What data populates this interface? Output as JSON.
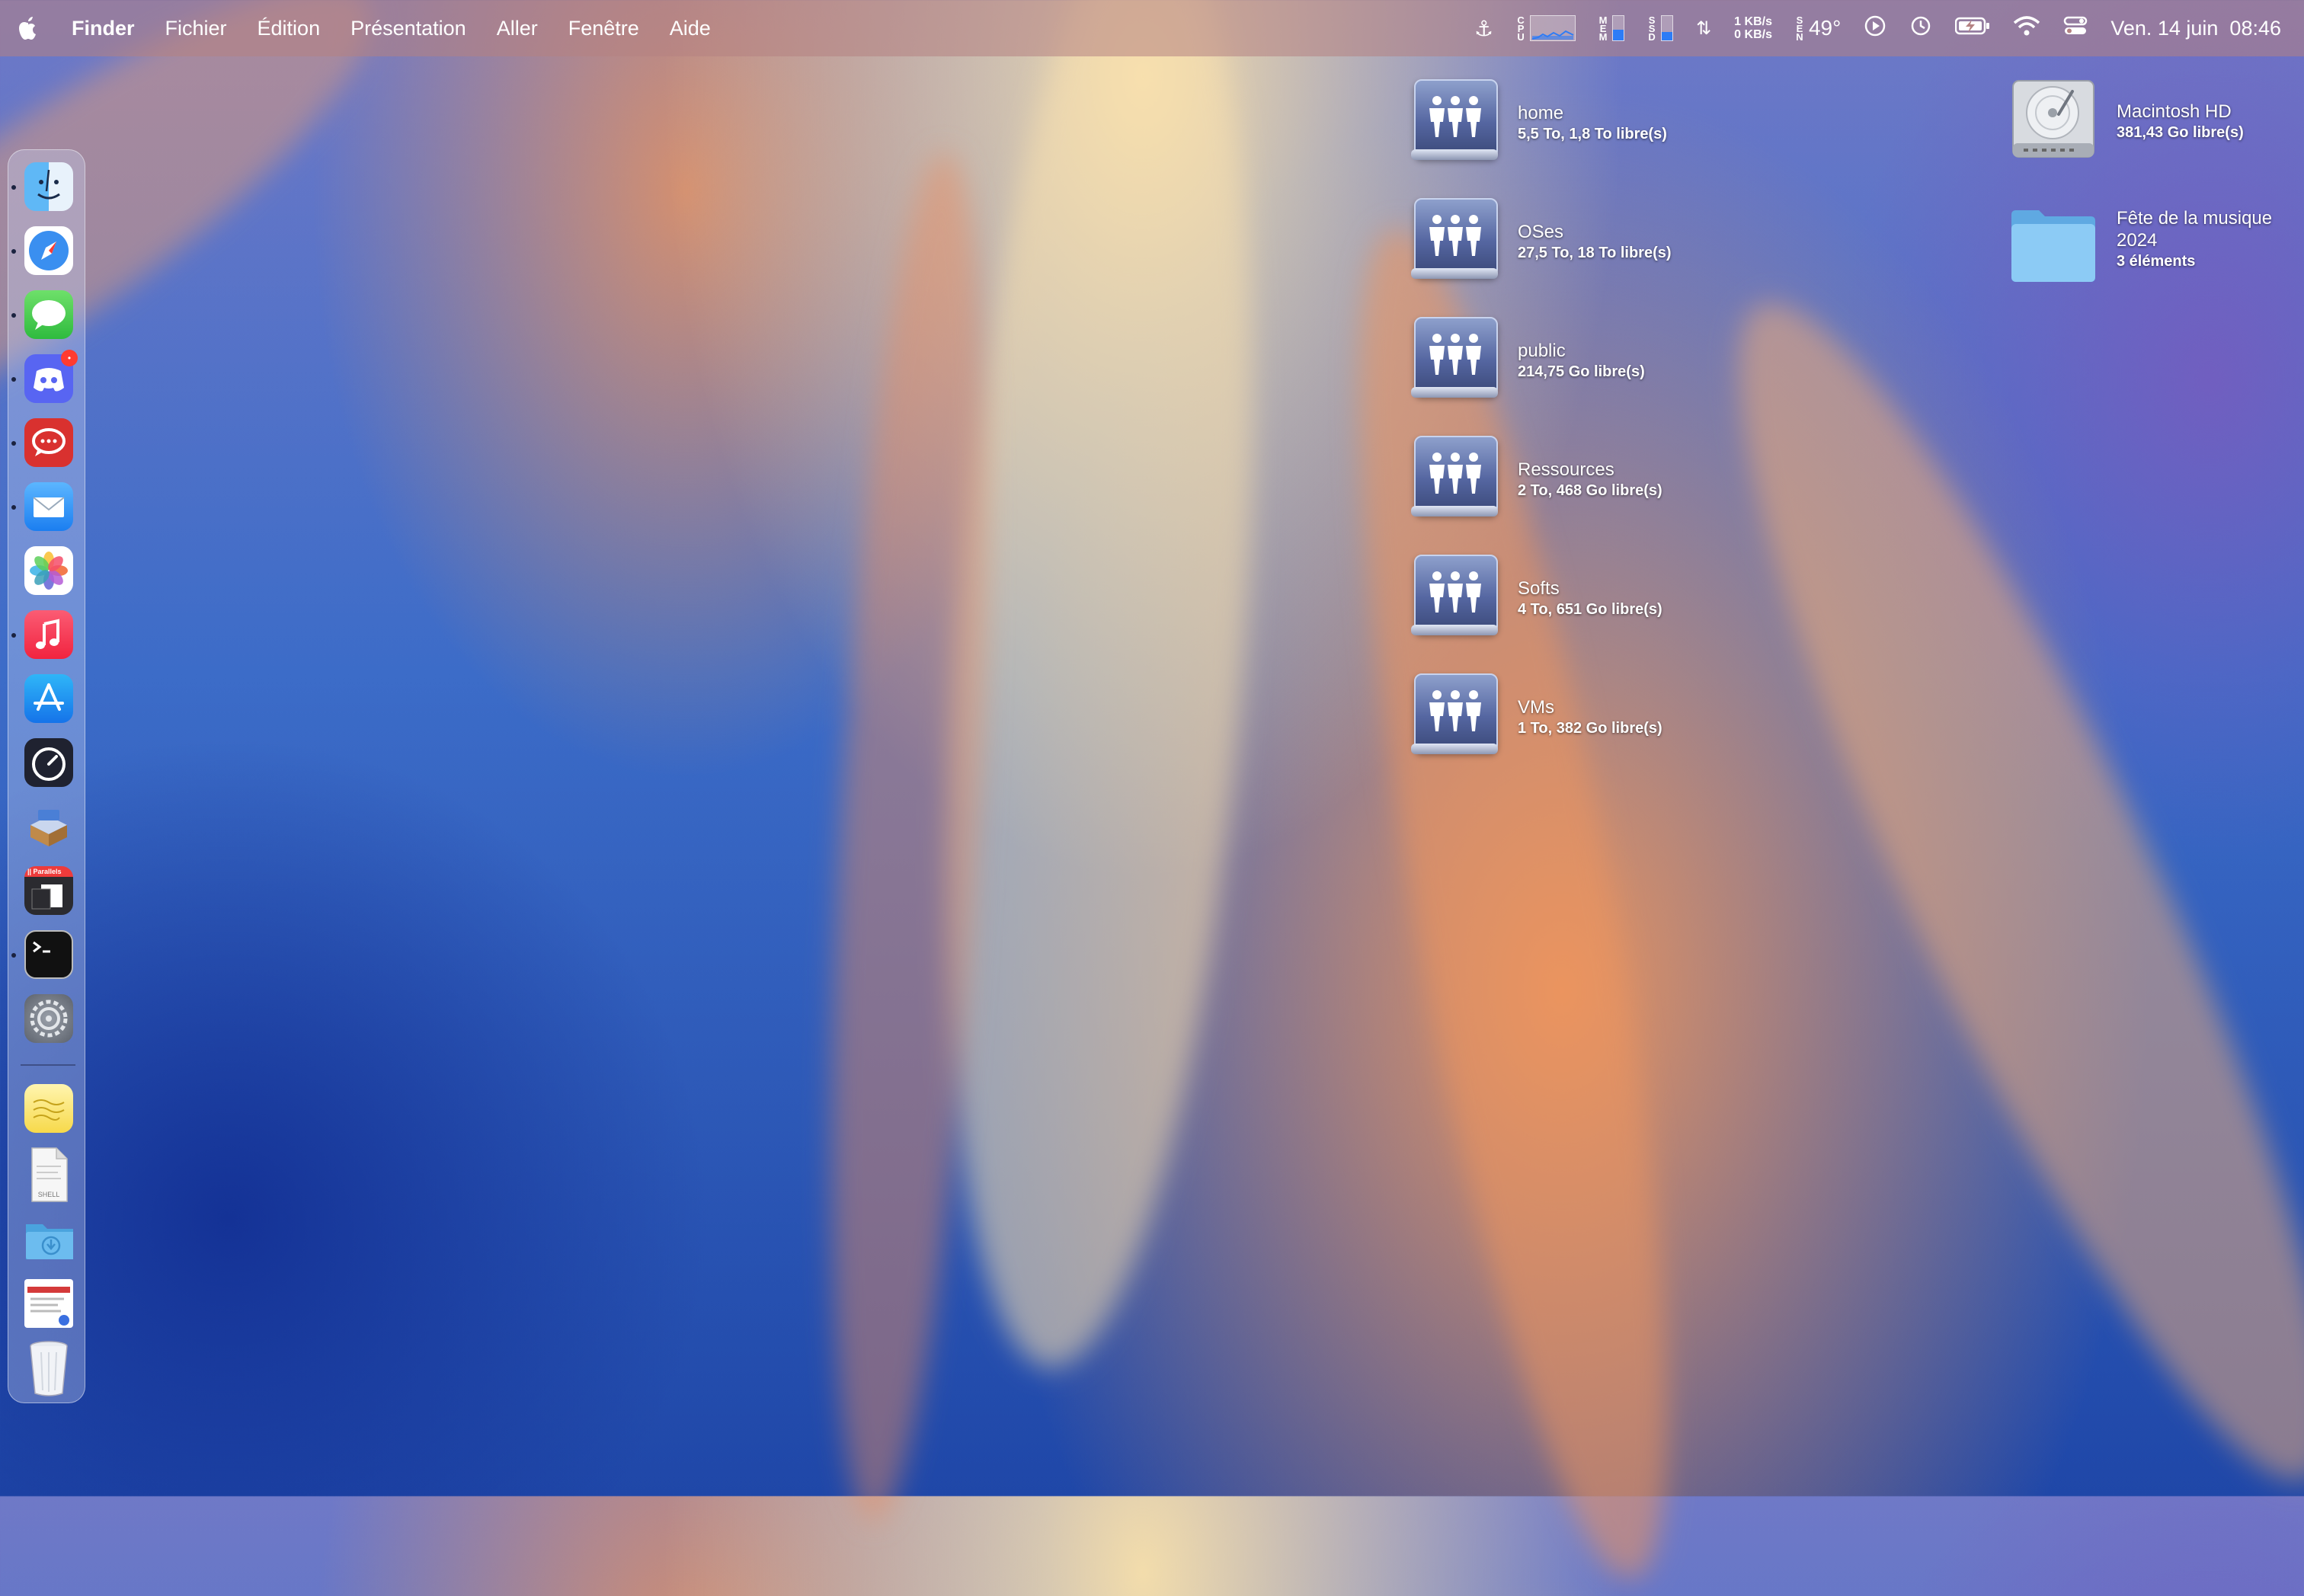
{
  "menubar": {
    "app_name": "Finder",
    "menus": [
      "Fichier",
      "Édition",
      "Présentation",
      "Aller",
      "Fenêtre",
      "Aide"
    ],
    "status": {
      "cpu_label": "CPU",
      "mem_label": "MEM",
      "ssd_label": "SSD",
      "mem_fill": 0.45,
      "ssd_fill": 0.35,
      "net_up": "1 KB/s",
      "net_down": "0 KB/s",
      "sensor_label": "SEN",
      "temperature": "49°",
      "datetime": "Ven. 14 juin  08:46"
    }
  },
  "dock": {
    "apps": [
      {
        "name": "finder-icon",
        "running": true
      },
      {
        "name": "safari-icon",
        "running": true
      },
      {
        "name": "messages-icon",
        "running": true
      },
      {
        "name": "discord-icon",
        "running": true,
        "badge": "•"
      },
      {
        "name": "speeko-icon",
        "running": true
      },
      {
        "name": "mail-icon",
        "running": true
      },
      {
        "name": "photos-icon",
        "running": false
      },
      {
        "name": "music-icon",
        "running": true
      },
      {
        "name": "app-store-icon",
        "running": false
      },
      {
        "name": "activity-gauge-icon",
        "running": false
      },
      {
        "name": "installer-icon",
        "running": false
      },
      {
        "name": "parallels-icon",
        "running": false,
        "label": "|| Parallels"
      },
      {
        "name": "terminal-icon",
        "running": true
      },
      {
        "name": "system-settings-icon",
        "running": false
      }
    ],
    "docs": [
      {
        "name": "stickies-icon"
      },
      {
        "name": "shell-script-icon",
        "label": "SHELL"
      },
      {
        "name": "downloads-folder-icon"
      },
      {
        "name": "screenshot-stack-icon"
      },
      {
        "name": "trash-icon"
      }
    ]
  },
  "shares": [
    {
      "name": "home",
      "info": "5,5 To, 1,8 To libre(s)"
    },
    {
      "name": "OSes",
      "info": "27,5 To, 18 To libre(s)"
    },
    {
      "name": "public",
      "info": "214,75 Go libre(s)"
    },
    {
      "name": "Ressources",
      "info": "2 To, 468 Go libre(s)"
    },
    {
      "name": "Softs",
      "info": "4 To, 651 Go libre(s)"
    },
    {
      "name": "VMs",
      "info": "1 To, 382 Go libre(s)"
    }
  ],
  "disk": {
    "name": "Macintosh HD",
    "info": "381,43 Go libre(s)"
  },
  "folder": {
    "name_line1": "Fête de la musique",
    "name_line2": "2024",
    "info": "3 éléments"
  },
  "colors": {
    "menubar_bg": "#b48282",
    "accent_blue": "#2d7cf6",
    "folder_blue": "#7fbfef"
  }
}
